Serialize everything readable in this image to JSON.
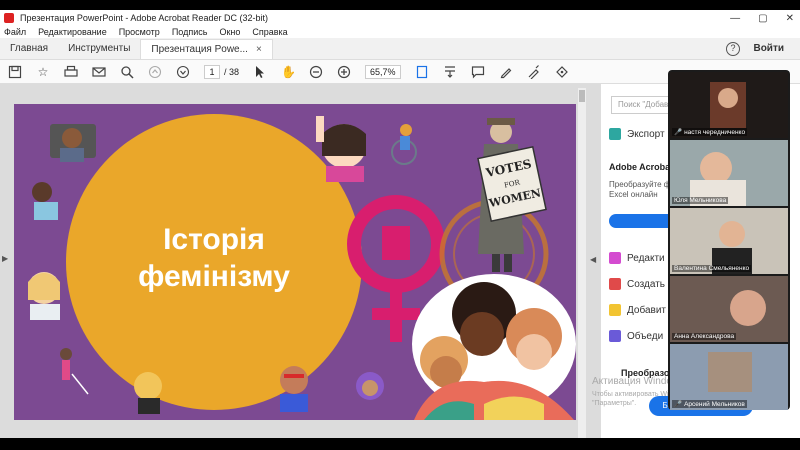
{
  "window": {
    "title": "Презентация PowerPoint - Adobe Acrobat Reader DC (32-bit)",
    "controls": [
      "—",
      "▢",
      "✕"
    ]
  },
  "menu": [
    "Файл",
    "Редактирование",
    "Просмотр",
    "Подпись",
    "Окно",
    "Справка"
  ],
  "tabs": {
    "home": "Главная",
    "tools": "Инструменты",
    "doc": "Презентация Powe...",
    "close": "×",
    "help": "?",
    "signin": "Войти"
  },
  "toolbar": {
    "page_current": "1",
    "page_total": "/ 38",
    "zoom": "65,7%"
  },
  "slide": {
    "title_line1": "Історія",
    "title_line2": "фемінізму",
    "sign_line1": "VOTES",
    "sign_line2": "FOR",
    "sign_line3": "WOMEN"
  },
  "right_pane": {
    "search_placeholder": "Поиск \"Добав",
    "export": "Экспорт",
    "promo_title": "Adobe Acrobat",
    "promo_text": "Преобразуйте фа Excel онлайн",
    "items": [
      "Редакти",
      "Создать",
      "Добавит",
      "Объеди"
    ],
    "convert_title": "Преобразов",
    "trial": "Бесплатная пробная версия"
  },
  "watermark": {
    "line1": "Активация Windows",
    "line2": "Чтобы активировать Windows, перейдите в раздел \"Параметры\"."
  },
  "participants": [
    {
      "name": "настя чередниченко"
    },
    {
      "name": "Юля Мельникова"
    },
    {
      "name": "Валентина Смельяненко"
    },
    {
      "name": "Анна Александрова"
    },
    {
      "name": "Арсений Мельников"
    }
  ],
  "colors": {
    "slide_bg": "#7c4a92",
    "yellow": "#eaa72a",
    "pink": "#d81e6e",
    "accent_blue": "#1a73e8"
  }
}
